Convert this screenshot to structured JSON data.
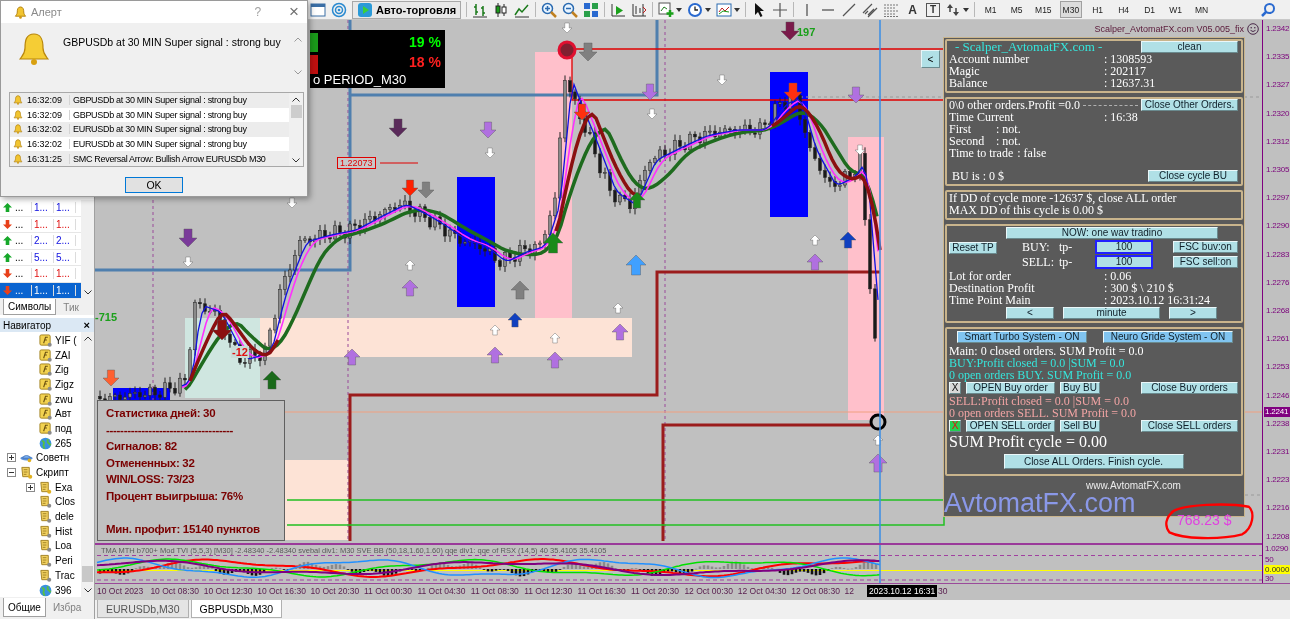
{
  "alert_dialog": {
    "title": "Алерт",
    "help": "?",
    "close": "×",
    "message": "GBPUSDb at 30 MIN Super signal : strong buy",
    "entries": [
      {
        "time": "16:32:09",
        "text": "GBPUSDb at 30 MIN Super signal : strong buy"
      },
      {
        "time": "16:32:09",
        "text": "GBPUSDb at 30 MIN Super signal : strong buy"
      },
      {
        "time": "16:32:02",
        "text": "EURUSDb at 30 MIN Super signal : strong buy"
      },
      {
        "time": "16:32:02",
        "text": "EURUSDb at 30 MIN Super signal : strong buy"
      },
      {
        "time": "16:31:25",
        "text": "SMC Reversal Arrow: Bullish Arrow EURUSDb M30"
      }
    ],
    "ok": "OK"
  },
  "toolbar": {
    "auto_trading": "Авто-торговля",
    "text_tool": "A",
    "label_tool": "T",
    "timeframes": [
      {
        "label": "M1",
        "selected": false
      },
      {
        "label": "M5",
        "selected": false
      },
      {
        "label": "M15",
        "selected": false
      },
      {
        "label": "M30",
        "selected": true
      },
      {
        "label": "H1",
        "selected": false
      },
      {
        "label": "H4",
        "selected": false
      },
      {
        "label": "D1",
        "selected": false
      },
      {
        "label": "W1",
        "selected": false
      },
      {
        "label": "MN",
        "selected": false
      }
    ]
  },
  "market_watch": {
    "rows": [
      {
        "rising": true,
        "symbol": "...",
        "bid": "1...",
        "ask": "1...",
        "selected": false
      },
      {
        "rising": false,
        "symbol": "...",
        "bid": "1...",
        "ask": "1...",
        "selected": false
      },
      {
        "rising": true,
        "symbol": "...",
        "bid": "2...",
        "ask": "2...",
        "selected": false
      },
      {
        "rising": true,
        "symbol": "...",
        "bid": "5...",
        "ask": "5...",
        "selected": false
      },
      {
        "rising": false,
        "symbol": "...",
        "bid": "1...",
        "ask": "1...",
        "selected": false
      },
      {
        "rising": false,
        "symbol": "...",
        "bid": "1...",
        "ask": "1...",
        "selected": true
      }
    ],
    "tabs": [
      {
        "label": "Символы",
        "selected": true
      },
      {
        "label": "Тик",
        "selected": false
      }
    ]
  },
  "navigator": {
    "title": "Навигатор",
    "close": "×",
    "tree": [
      {
        "children": [
          {
            "kind": "indicator",
            "label": "YIF ("
          },
          {
            "kind": "indicator",
            "label": "ZAI"
          },
          {
            "kind": "indicator",
            "label": "Zig"
          },
          {
            "kind": "indicator",
            "label": "Zigz"
          },
          {
            "kind": "indicator",
            "label": "zwu"
          },
          {
            "kind": "indicator",
            "label": "Авт"
          },
          {
            "kind": "indicator",
            "label": "под"
          },
          {
            "kind": "link",
            "label": "265"
          }
        ]
      },
      {
        "kind": "experts",
        "label": "Советн",
        "expanded": false
      },
      {
        "kind": "scripts",
        "label": "Скрипт",
        "expanded": true,
        "children": [
          {
            "kind": "scripts",
            "label": "Exa",
            "expanded": false
          },
          {
            "kind": "script",
            "label": "Clos"
          },
          {
            "kind": "script",
            "label": "dele"
          },
          {
            "kind": "script",
            "label": "Hist"
          },
          {
            "kind": "script",
            "label": "Loa"
          },
          {
            "kind": "script",
            "label": "Peri"
          },
          {
            "kind": "script",
            "label": "Trac"
          },
          {
            "kind": "link",
            "label": "396"
          }
        ]
      }
    ],
    "tabs": [
      {
        "label": "Общие",
        "selected": true
      },
      {
        "label": "Избра",
        "selected": false
      }
    ]
  },
  "chart": {
    "title": "Scalper_AvtomatFX.com V05.005_fix",
    "signal_box": {
      "buy": "19 %",
      "sell": "18 %",
      "period": "o PERIOD_M30"
    },
    "level_label": "1.22073",
    "left_label": "-715",
    "loss_label": "-12",
    "top_label": "197",
    "statistics": {
      "title": "Статистика дней: 30",
      "rule": "------------------------------------",
      "items": [
        "Сигналов: 82",
        "Отмененных: 32",
        "WIN/LOSS: 73/23",
        "Процент выигрыша: 76%"
      ],
      "footer": "Мин. профит: 15140 пунктов"
    },
    "collapse_button": "<",
    "site_url": "www.AvtomatFX.com",
    "brand": "AvtomatFX.com",
    "profit_badge": "768.23 $",
    "price_axis": {
      "labels": [
        "1.2342",
        "1.2335",
        "1.2327",
        "1.2320",
        "1.2312",
        "1.2305",
        "1.2297",
        "1.2290",
        "1.2283",
        "1.2276",
        "1.2268",
        "1.2261",
        "1.2253",
        "1.2246",
        "1.2238",
        "1.2231",
        "1.2223",
        "1.2216",
        "1.2208"
      ],
      "current": "1.2241"
    }
  },
  "trading_panel": {
    "header": {
      "title": "- Scalper_AvtomatFX.com -",
      "button": "clean",
      "rows": [
        {
          "label": "Account number",
          "value": ": 1308593"
        },
        {
          "label": "Magic",
          "value": ": 202117"
        },
        {
          "label": "Balance",
          "value": ": 12637.31"
        }
      ]
    },
    "orders": {
      "other": "0\\0 other orders.Profit =0.0",
      "button": "Close Other Orders.",
      "rows": [
        {
          "kind": "column",
          "label": "Time Current",
          "value": ": 16:38"
        },
        {
          "kind": "inline",
          "label": "First",
          "value": ": not."
        },
        {
          "kind": "inline",
          "label": "Second",
          "value": ": not."
        },
        {
          "kind": "inline",
          "label": "Time to trade",
          "value": ":  false"
        }
      ],
      "bu": "BU is :  0 $",
      "bu_button": "Close cycle BU"
    },
    "drawdown": [
      "If DD of cycle more -12637 $, close ALL order",
      "MAX DD of this cycle is 0.00 $"
    ],
    "trade": {
      "mode_button": "NOW: one wav tradino",
      "reset_button": "Reset TP",
      "sides": [
        {
          "side": "BUY:",
          "tp": "tp-",
          "value": "100",
          "button": "FSC buv:on"
        },
        {
          "side": "SELL:",
          "tp": "tp-",
          "value": "100",
          "button": "FSC sell:on"
        }
      ],
      "rows": [
        {
          "label": "Lot for order",
          "value": ": 0.06"
        },
        {
          "label": "Destination Profit",
          "value": ": 300 $ \\ 210 $"
        },
        {
          "label": "Time Point Main",
          "value": ": 2023.10.12 16:31:24"
        }
      ],
      "nav": [
        "<",
        "minute",
        ">"
      ]
    },
    "systems": {
      "buttons": [
        "Smart Turbo System - ON",
        "Neuro Gride System - ON"
      ],
      "main": "Main: 0 closed orders. SUM Profit = 0.0",
      "sides": [
        {
          "kind": "buy",
          "lines": [
            "BUY:Profit closed = 0.0 |SUM = 0.0",
            "0 open orders BUY. SUM Profit = 0.0"
          ],
          "toggle": {
            "label": "X",
            "on": false
          },
          "open_button": "OPEN Buy order",
          "bu_button": "Buy BU",
          "close_button": "Close Buy orders"
        },
        {
          "kind": "sell",
          "lines": [
            "SELL:Profit closed = 0.0 |SUM = 0.0",
            "0 open orders SELL. SUM Profit = 0.0"
          ],
          "toggle": {
            "label": "X",
            "on": true
          },
          "open_button": "OPEN SELL order",
          "bu_button": "Sell BU",
          "close_button": "Close SELL orders"
        }
      ],
      "sum": "SUM Profit cycle = 0.00",
      "close_all": "Close ALL Orders. Finish cycle."
    }
  },
  "indicator": {
    "header": "TMA MTH b700+ Mod TVI (5,5,3) [M30] -2.48340 -2.48340 svebal div1: M30 SVE BB (50,18,1.60,1.60) qqe div1: qqe of RSX (14,5) 40 35.4105 35.4105",
    "axis_labels": [
      "1.0290",
      "50",
      "30"
    ],
    "zero_label": "0.0000"
  },
  "time_axis": {
    "labels": [
      "10 Oct 2023",
      "10 Oct 08:30",
      "10 Oct 12:30",
      "10 Oct 16:30",
      "10 Oct 20:30",
      "11 Oct 00:30",
      "11 Oct 04:30",
      "11 Oct 08:30",
      "11 Oct 12:30",
      "11 Oct 16:30",
      "11 Oct 20:30",
      "12 Oct 00:30",
      "12 Oct 04:30",
      "12 Oct 08:30",
      "12"
    ],
    "cursor": "2023.10.12 16:31",
    "tail": "30"
  },
  "chart_tabs": [
    {
      "label": "EURUSDb,M30",
      "selected": false
    },
    {
      "label": "GBPUSDb,M30",
      "selected": true
    }
  ]
}
